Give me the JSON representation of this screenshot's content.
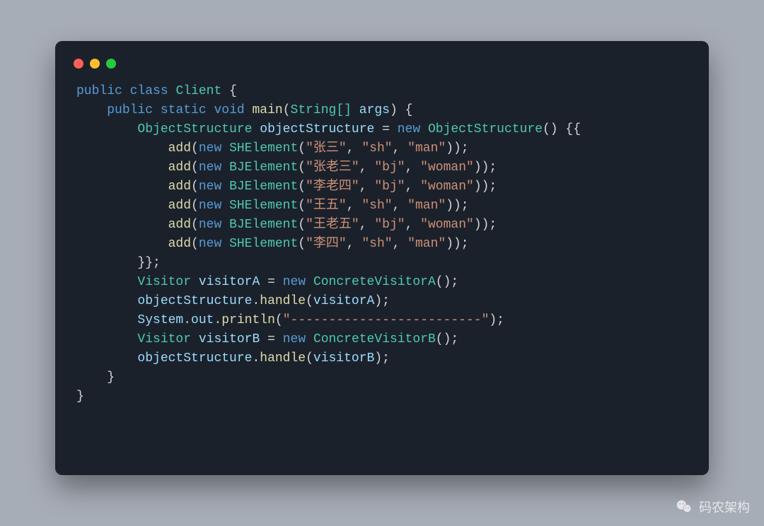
{
  "code": {
    "class_name": "Client",
    "method_sig": {
      "mods": "public static void",
      "name": "main",
      "arg_type": "String[]",
      "arg_name": "args"
    },
    "obj_struct_type": "ObjectStructure",
    "obj_struct_var": "objectStructure",
    "adds": [
      {
        "fn": "add",
        "ctor": "SHElement",
        "a": "张三",
        "b": "sh",
        "c": "man"
      },
      {
        "fn": "add",
        "ctor": "BJElement",
        "a": "张老三",
        "b": "bj",
        "c": "woman"
      },
      {
        "fn": "add",
        "ctor": "BJElement",
        "a": "李老四",
        "b": "bj",
        "c": "woman"
      },
      {
        "fn": "add",
        "ctor": "SHElement",
        "a": "王五",
        "b": "sh",
        "c": "man"
      },
      {
        "fn": "add",
        "ctor": "BJElement",
        "a": "王老五",
        "b": "bj",
        "c": "woman"
      },
      {
        "fn": "add",
        "ctor": "SHElement",
        "a": "李四",
        "b": "sh",
        "c": "man"
      }
    ],
    "visitor_type": "Visitor",
    "visitorA_var": "visitorA",
    "visitorA_ctor": "ConcreteVisitorA",
    "handle_fn": "handle",
    "println_owner": "System.out",
    "println_fn": "println",
    "println_arg": "-------------------------",
    "visitorB_var": "visitorB",
    "visitorB_ctor": "ConcreteVisitorB"
  },
  "kw": {
    "public": "public",
    "class": "class",
    "static": "static",
    "void": "void",
    "new": "new"
  },
  "watermark": "码农架构"
}
